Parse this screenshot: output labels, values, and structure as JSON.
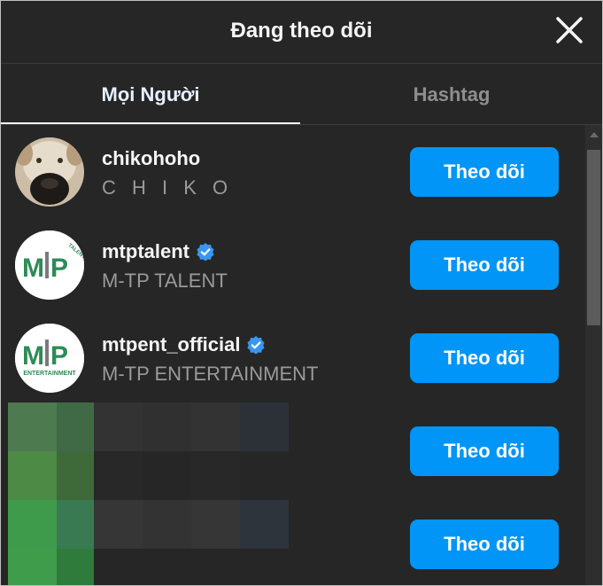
{
  "header": {
    "title": "Đang theo dõi"
  },
  "tabs": [
    {
      "label": "Mọi Người",
      "active": true
    },
    {
      "label": "Hashtag",
      "active": false
    }
  ],
  "users": [
    {
      "username": "chikohoho",
      "fullname": "C H I K O",
      "verified": false,
      "button": "Theo dõi"
    },
    {
      "username": "mtptalent",
      "fullname": "M-TP TALENT",
      "verified": true,
      "button": "Theo dõi",
      "logo_text": "M-TP TALENT"
    },
    {
      "username": "mtpent_official",
      "fullname": "M-TP ENTERTAINMENT",
      "verified": true,
      "button": "Theo dõi",
      "logo_text": "ENTERTAINMENT"
    },
    {
      "username": "",
      "fullname": "",
      "verified": false,
      "button": "Theo dõi",
      "pixelated": true
    },
    {
      "username": "",
      "fullname": "",
      "verified": false,
      "button": "Theo dõi",
      "pixelated": true
    }
  ],
  "colors": {
    "background": "#262626",
    "button": "#0095f6",
    "verified": "#3897f0",
    "logo_green": "#2e8b57"
  },
  "icons": {
    "close": "close-icon",
    "verified": "verified-badge-icon"
  }
}
